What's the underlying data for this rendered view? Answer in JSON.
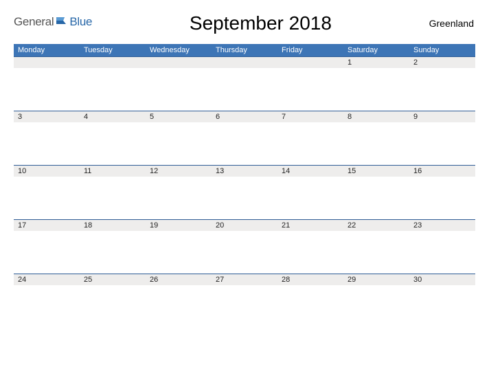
{
  "header": {
    "logo": {
      "general": "General",
      "blue": "Blue"
    },
    "title": "September 2018",
    "region": "Greenland"
  },
  "weekdays": [
    "Monday",
    "Tuesday",
    "Wednesday",
    "Thursday",
    "Friday",
    "Saturday",
    "Sunday"
  ],
  "weeks": [
    [
      "",
      "",
      "",
      "",
      "",
      "1",
      "2"
    ],
    [
      "3",
      "4",
      "5",
      "6",
      "7",
      "8",
      "9"
    ],
    [
      "10",
      "11",
      "12",
      "13",
      "14",
      "15",
      "16"
    ],
    [
      "17",
      "18",
      "19",
      "20",
      "21",
      "22",
      "23"
    ],
    [
      "24",
      "25",
      "26",
      "27",
      "28",
      "29",
      "30"
    ]
  ],
  "colors": {
    "brand_blue": "#3d75b6",
    "border_blue": "#2d5b95",
    "header_gray": "#eeedec"
  }
}
